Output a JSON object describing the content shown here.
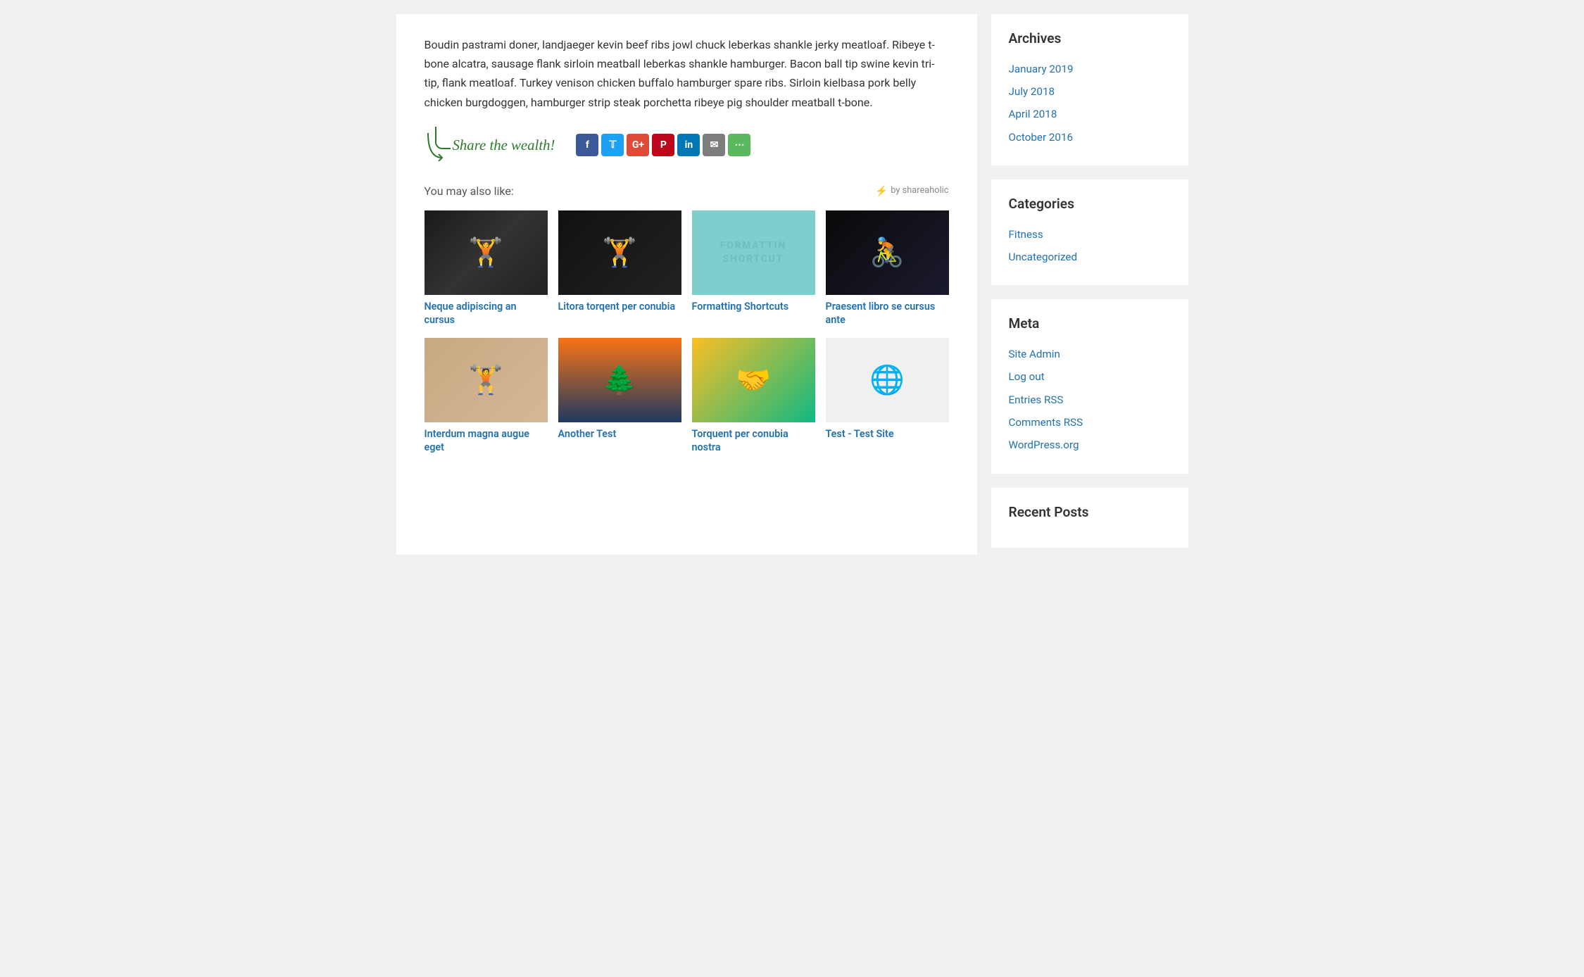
{
  "main": {
    "article_text": "Boudin pastrami doner, landjaeger kevin beef ribs jowl chuck leberkas shankle jerky meatloaf. Ribeye t-bone alcatra, sausage flank sirloin meatball leberkas shankle hamburger. Bacon ball tip swine kevin tri-tip, flank meatloaf. Turkey venison chicken buffalo hamburger spare ribs. Sirloin kielbasa pork belly chicken burgdoggen, hamburger strip steak porchetta ribeye pig shoulder meatball t-bone.",
    "share_label": "Share the wealth!",
    "you_may_also_like": "You may also like:",
    "by_shareaholic": "by shareaholic",
    "cards_row1": [
      {
        "title": "Neque adipiscing an cursus",
        "img_type": "fitness1"
      },
      {
        "title": "Litora torqent per conubia",
        "img_type": "squat"
      },
      {
        "title": "Formatting Shortcuts",
        "img_type": "formatting"
      },
      {
        "title": "Praesent libro se cursus ante",
        "img_type": "cycling"
      }
    ],
    "cards_row2": [
      {
        "title": "Interdum magna augue eget",
        "img_type": "seated"
      },
      {
        "title": "Another Test",
        "img_type": "winter"
      },
      {
        "title": "Torquent per conubia nostra",
        "img_type": "friends"
      },
      {
        "title": "Test - Test Site",
        "img_type": "website"
      }
    ]
  },
  "sidebar": {
    "archives_title": "Archives",
    "archives": [
      {
        "label": "January 2019",
        "href": "#"
      },
      {
        "label": "July 2018",
        "href": "#"
      },
      {
        "label": "April 2018",
        "href": "#"
      },
      {
        "label": "October 2016",
        "href": "#"
      }
    ],
    "categories_title": "Categories",
    "categories": [
      {
        "label": "Fitness",
        "href": "#"
      },
      {
        "label": "Uncategorized",
        "href": "#"
      }
    ],
    "meta_title": "Meta",
    "meta": [
      {
        "label": "Site Admin",
        "href": "#"
      },
      {
        "label": "Log out",
        "href": "#"
      },
      {
        "label": "Entries RSS",
        "href": "#"
      },
      {
        "label": "Comments RSS",
        "href": "#"
      },
      {
        "label": "WordPress.org",
        "href": "#"
      }
    ],
    "recent_posts_title": "Recent Posts"
  },
  "formatting_text_line1": "FORMATTIN",
  "formatting_text_line2": "SHORTCUT"
}
